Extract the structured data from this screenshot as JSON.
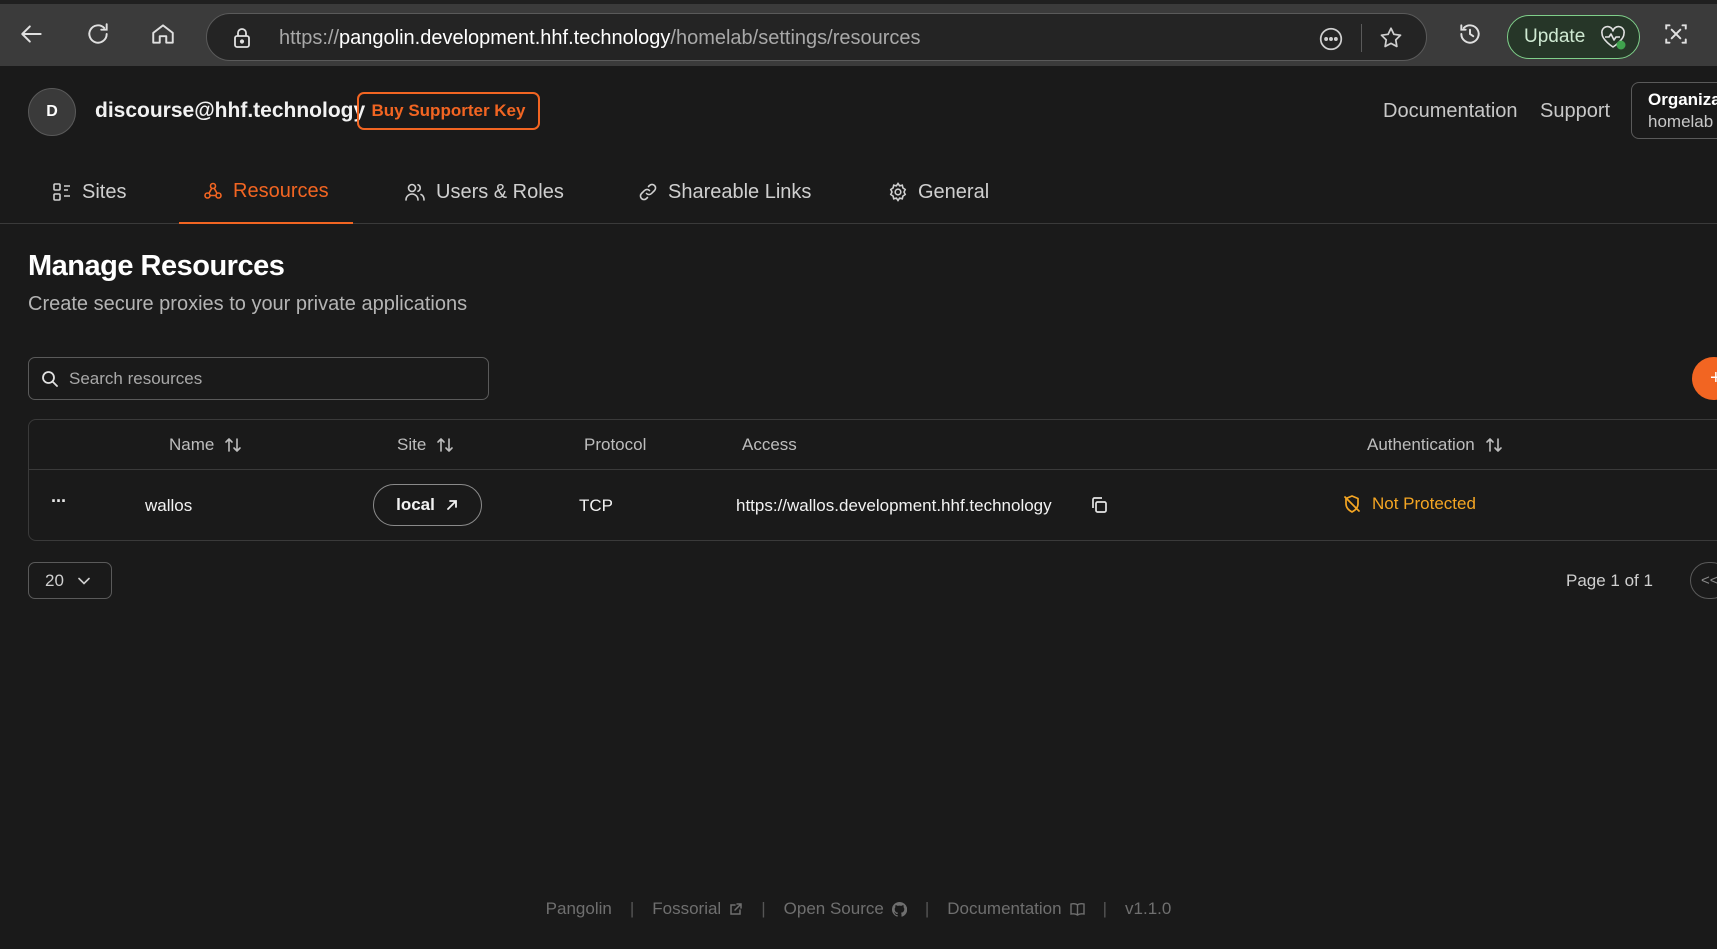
{
  "browser": {
    "url_scheme": "https://",
    "url_host": "pangolin.development.hhf.technology",
    "url_path": "/homelab/settings/resources",
    "update_label": "Update"
  },
  "header": {
    "avatar_initial": "D",
    "user_email": "discourse@hhf.technology",
    "supporter_button": "Buy Supporter Key",
    "links": [
      "Documentation",
      "Support"
    ],
    "org_label": "Organiza",
    "org_name": "homelab"
  },
  "tabs": [
    {
      "label": "Sites",
      "active": false
    },
    {
      "label": "Resources",
      "active": true
    },
    {
      "label": "Users & Roles",
      "active": false
    },
    {
      "label": "Shareable Links",
      "active": false
    },
    {
      "label": "General",
      "active": false
    }
  ],
  "main": {
    "title": "Manage Resources",
    "subtitle": "Create secure proxies to your private applications",
    "search_placeholder": "Search resources",
    "add_button": "+"
  },
  "table": {
    "columns": [
      "Name",
      "Site",
      "Protocol",
      "Access",
      "Authentication"
    ],
    "rows": [
      {
        "actions": "···",
        "name": "wallos",
        "site": "local",
        "protocol": "TCP",
        "access": "https://wallos.development.hhf.technology",
        "authentication": "Not Protected"
      }
    ]
  },
  "pagination": {
    "page_size": "20",
    "page_info": "Page 1 of 1",
    "first_label": "<<"
  },
  "footer": {
    "items": [
      "Pangolin",
      "Fossorial",
      "Open Source",
      "Documentation",
      "v1.1.0"
    ]
  },
  "colors": {
    "accent": "#f26522",
    "warning": "#f5a623",
    "background": "#1a1a1a",
    "update_green": "#7fcf8a"
  }
}
